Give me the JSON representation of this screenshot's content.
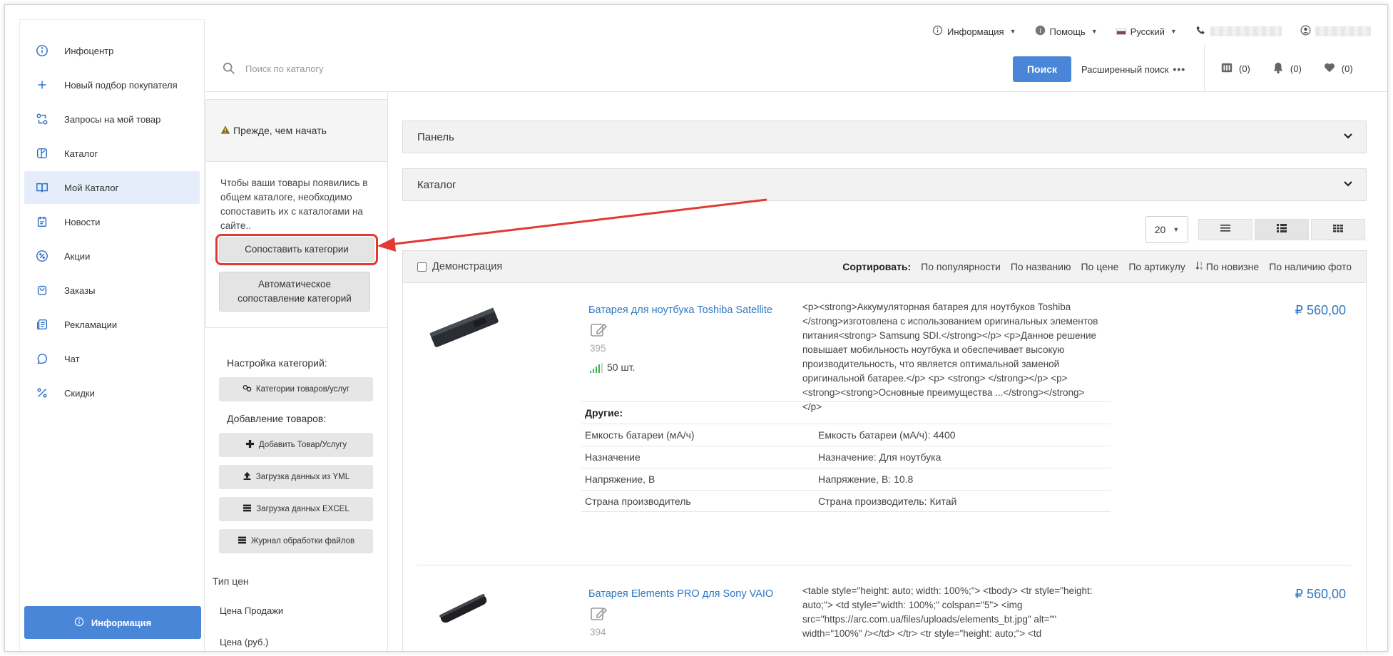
{
  "sidebar": {
    "items": [
      {
        "label": "Инфоцентр",
        "icon": "info-icon"
      },
      {
        "label": "Новый подбор покупателя",
        "icon": "plus-icon"
      },
      {
        "label": "Запросы на мой товар",
        "icon": "exchange-icon"
      },
      {
        "label": "Каталог",
        "icon": "catalog-icon"
      },
      {
        "label": "Мой Каталог",
        "icon": "book-icon",
        "active": true
      },
      {
        "label": "Новости",
        "icon": "news-icon"
      },
      {
        "label": "Акции",
        "icon": "percent-badge-icon"
      },
      {
        "label": "Заказы",
        "icon": "bag-icon"
      },
      {
        "label": "Рекламации",
        "icon": "claims-icon"
      },
      {
        "label": "Чат",
        "icon": "chat-icon"
      },
      {
        "label": "Скидки",
        "icon": "percent-icon"
      }
    ],
    "info_button": "Информация"
  },
  "topbar": {
    "info": "Информация",
    "help": "Помощь",
    "language": "Русский"
  },
  "search": {
    "placeholder": "Поиск по каталогу",
    "button": "Поиск",
    "advanced": "Расширенный поиск",
    "compare_count": "(0)",
    "notifications_count": "(0)",
    "favorites_count": "(0)"
  },
  "notice": {
    "title": "Прежде, чем начать",
    "text": "Чтобы ваши товары появились в общем каталоге, необходимо сопоставить их с каталогами на сайте..",
    "map_button": "Сопоставить категории",
    "auto_button": "Автоматическое сопоставление категорий"
  },
  "settings": {
    "categories_label": "Настройка категорий:",
    "categories_button": "Категории товаров/услуг",
    "adding_label": "Добавление товаров:",
    "add_button": "Добавить Товар/Услугу",
    "yml_button": "Загрузка данных из YML",
    "excel_button": "Загрузка данных EXCEL",
    "log_button": "Журнал обработки файлов",
    "price_type_label": "Тип цен",
    "price_items": [
      "Цена Продажи",
      "Цена (руб.)"
    ]
  },
  "accordions": [
    "Панель",
    "Каталог"
  ],
  "toolbar": {
    "per_page": "20"
  },
  "sort": {
    "demo_label": "Демонстрация",
    "label": "Сортировать:",
    "options": [
      "По популярности",
      "По названию",
      "По цене",
      "По артикулу",
      "По новизне",
      "По наличию фото"
    ]
  },
  "products": [
    {
      "title": "Батарея для ноутбука Toshiba Satellite",
      "code": "395",
      "stock": "50 шт.",
      "price": "₽ 560,00",
      "description": "<p><strong>Аккумуляторная батарея для ноутбуков Toshiba </strong>изготовлена с использованием оригинальных элементов питания<strong> Samsung SDI.</strong></p> <p>Данное решение повышает мобильность ноутбука и обеспечивает высокую производительность, что является оптимальной заменой оригинальной батарее.</p> <p> <strong> </strong></p> <p><strong><strong>Основные преимущества ...</strong></strong></p>",
      "props_title": "Другие:",
      "props": [
        [
          "Емкость батареи (мА/ч)",
          "Емкость батареи (мА/ч): 4400"
        ],
        [
          "Назначение",
          "Назначение: Для ноутбука"
        ],
        [
          "Напряжение, В",
          "Напряжение, В: 10.8"
        ],
        [
          "Страна производитель",
          "Страна производитель: Китай"
        ]
      ]
    },
    {
      "title": "Батарея Elements PRO для Sony VAIO",
      "code": "394",
      "price": "₽ 560,00",
      "description": "<table style=\"height: auto; width: 100%;\"> <tbody> <tr style=\"height: auto;\"> <td style=\"width: 100%;\" colspan=\"5\"> <img src=\"https://arc.com.ua/files/uploads/elements_bt.jpg\" alt=\"\" width=\"100%\" /></td> </tr> <tr style=\"height: auto;\"> <td"
    }
  ],
  "colors": {
    "accent": "#4a86d8",
    "link": "#2f78c4",
    "highlight": "#e03a33"
  }
}
